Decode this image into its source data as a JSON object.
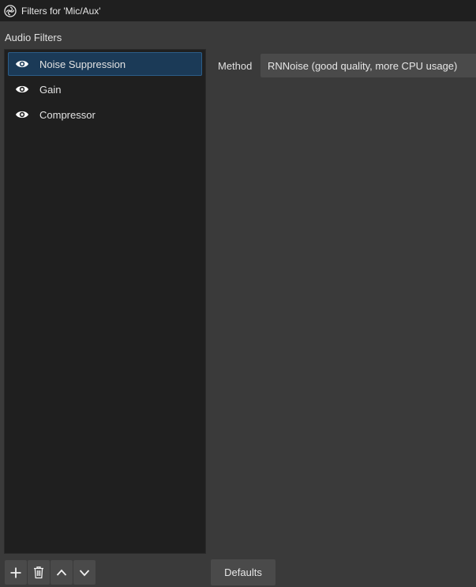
{
  "window": {
    "title": "Filters for 'Mic/Aux'",
    "app_icon": "obs-logo-icon"
  },
  "section_label": "Audio Filters",
  "filters": [
    {
      "label": "Noise Suppression",
      "visible": true,
      "selected": true,
      "icon": "eye-icon"
    },
    {
      "label": "Gain",
      "visible": true,
      "selected": false,
      "icon": "eye-icon"
    },
    {
      "label": "Compressor",
      "visible": true,
      "selected": false,
      "icon": "eye-icon"
    }
  ],
  "properties": {
    "method_label": "Method",
    "method_value": "RNNoise (good quality, more CPU usage)"
  },
  "toolbar": {
    "buttons": [
      {
        "name": "add",
        "icon": "plus-icon"
      },
      {
        "name": "remove",
        "icon": "trash-icon"
      },
      {
        "name": "move-up",
        "icon": "chevron-up-icon"
      },
      {
        "name": "move-down",
        "icon": "chevron-down-icon"
      }
    ],
    "defaults_label": "Defaults"
  },
  "colors": {
    "window_bg": "#3a3a3a",
    "titlebar_bg": "#1f1f1f",
    "list_bg": "#1f1f1f",
    "selected_bg": "#1b3a57",
    "selected_border": "#2c5d88",
    "button_bg": "#4a4a4a",
    "text": "#e0e0e0"
  }
}
